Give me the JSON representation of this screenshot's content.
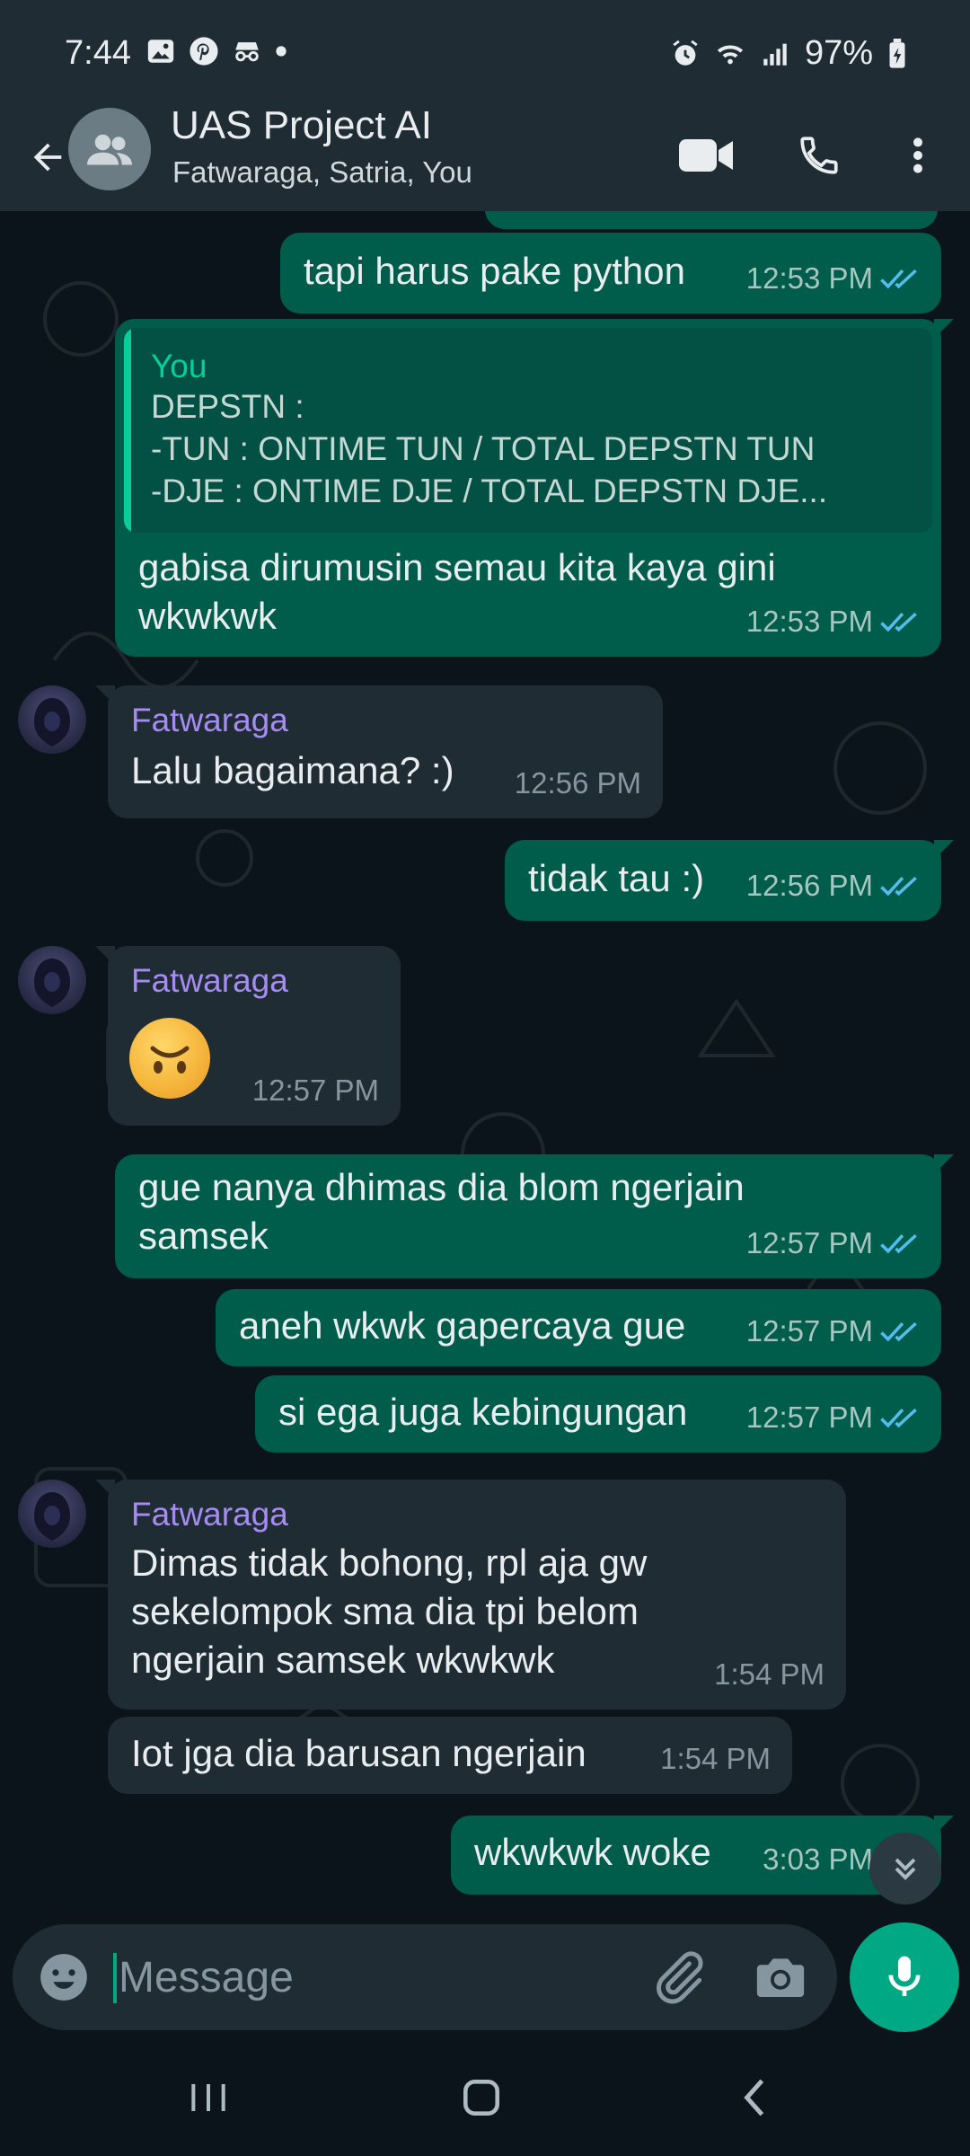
{
  "status_bar": {
    "time": "7:44",
    "battery": "97%",
    "left_icons": [
      "gallery-icon",
      "pinterest-icon",
      "incognito-icon",
      "dot-icon"
    ],
    "right_icons": [
      "alarm-icon",
      "wifi-icon",
      "signal-icon",
      "battery-icon"
    ]
  },
  "header": {
    "title": "UAS Project AI",
    "subtitle": "Fatwaraga, Satria, You",
    "icons": [
      "back-arrow-icon",
      "group-avatar-icon",
      "video-call-icon",
      "phone-call-icon",
      "more-options-icon"
    ]
  },
  "messages": [
    {
      "type": "out",
      "text": "tapi harus pake python",
      "time": "12:53 PM",
      "read": true
    },
    {
      "type": "out",
      "quote": {
        "author": "You",
        "text": "DEPSTN :\n-TUN : ONTIME TUN / TOTAL DEPSTN TUN\n-DJE : ONTIME DJE / TOTAL DEPSTN DJE..."
      },
      "text": "gabisa dirumusin semau kita kaya gini\nwkwkwk",
      "time": "12:53 PM",
      "read": true
    },
    {
      "type": "in",
      "sender": "Fatwaraga",
      "text": "Lalu bagaimana? :)",
      "time": "12:56 PM"
    },
    {
      "type": "out",
      "text": "tidak tau :)",
      "time": "12:56 PM",
      "read": true
    },
    {
      "type": "in",
      "sender": "Fatwaraga",
      "emoji": "upside-down-face-emoji",
      "time": "12:57 PM"
    },
    {
      "type": "out",
      "text": "gue nanya dhimas dia blom ngerjain\nsamsek",
      "time": "12:57 PM",
      "read": true
    },
    {
      "type": "out",
      "text": "aneh wkwk gapercaya gue",
      "time": "12:57 PM",
      "read": true
    },
    {
      "type": "out",
      "text": "si ega juga kebingungan",
      "time": "12:57 PM",
      "read": true
    },
    {
      "type": "in",
      "sender": "Fatwaraga",
      "text": "Dimas tidak bohong, rpl aja gw\nsekelompok sma dia tpi belom\nngerjain samsek wkwkwk",
      "time": "1:54 PM"
    },
    {
      "type": "in",
      "text": "Iot jga dia barusan ngerjain",
      "time": "1:54 PM"
    },
    {
      "type": "out",
      "text": "wkwkwk woke",
      "time": "3:03 PM",
      "read": true
    }
  ],
  "composer": {
    "placeholder": "Message",
    "icons": [
      "emoji-icon",
      "attach-icon",
      "camera-icon",
      "mic-icon"
    ]
  },
  "colors": {
    "header_bg": "#1f2c34",
    "chat_bg": "#0b141a",
    "outgoing_bubble": "#005c4b",
    "incoming_bubble": "#1f2c34",
    "accent": "#00a884",
    "sender_name": "#a68cf2",
    "read_ticks": "#53bdeb"
  }
}
